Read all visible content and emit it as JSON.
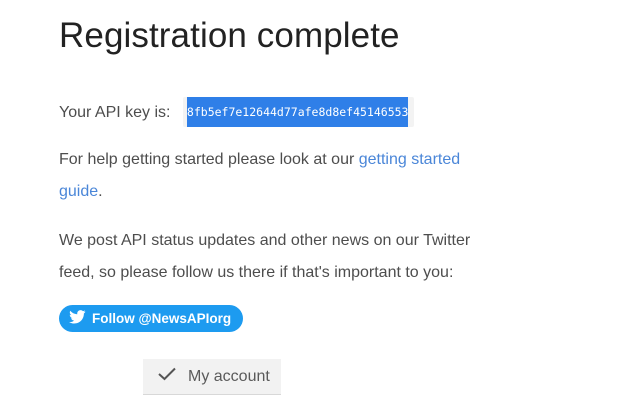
{
  "page": {
    "title": "Registration complete"
  },
  "api": {
    "label": "Your API key is:",
    "key": "8fb5ef7e12644d77afe8d8ef45146553"
  },
  "help": {
    "text_before": "For help getting started please look at our ",
    "link_text": "getting started guide",
    "text_after": "."
  },
  "news": {
    "text": "We post API status updates and other news on our Twitter feed, so please follow us there if that's important to you:"
  },
  "twitter_button": {
    "label": "Follow @NewsAPIorg",
    "icon": "twitter-bird-icon",
    "color": "#1d9bf0"
  },
  "account_button": {
    "label": "My account",
    "icon": "checkmark-icon"
  },
  "colors": {
    "link": "#4a86d8",
    "key_highlight": "#2f7fe8"
  }
}
